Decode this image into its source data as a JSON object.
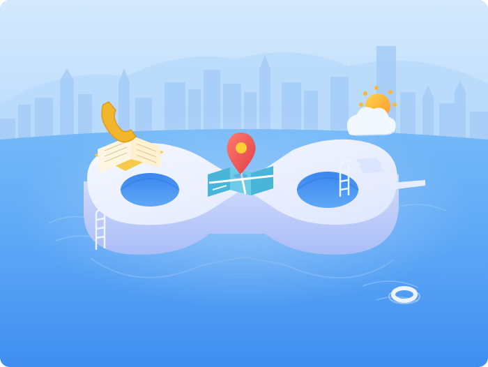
{
  "illustration": {
    "palette": {
      "sky_top": "#cfe6fd",
      "sky_bottom": "#8ec6fa",
      "water_top": "#6cb5f8",
      "water_bottom": "#3f8ef0",
      "infinity_surface": "#eef3fe",
      "infinity_side": "#c4d2fb",
      "map_pin": "#f05a5a",
      "sun": "#ffb733",
      "book": "#f5c94a",
      "phone": "#f2b62c",
      "cloud": "#f2f8ff",
      "float_ring": "#eaf3ff"
    },
    "icons": [
      "telephone-icon",
      "book-icon",
      "map-icon",
      "location-pin-icon",
      "sun-cloud-icon",
      "ladder-icon",
      "swim-ring-icon"
    ]
  }
}
